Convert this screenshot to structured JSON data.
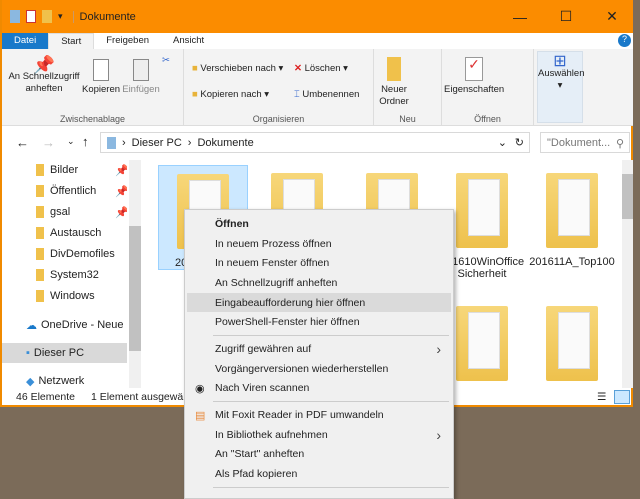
{
  "window": {
    "title": "Dokumente",
    "minimize": "—",
    "maximize": "☐",
    "close": "✕"
  },
  "ribbon_tabs": [
    "Datei",
    "Start",
    "Freigeben",
    "Ansicht"
  ],
  "ribbon": {
    "pin": "An Schnellzugriff anheften",
    "copy": "Kopieren",
    "paste": "Einfügen",
    "group_clipboard": "Zwischenablage",
    "move_to": "Verschieben nach ▾",
    "copy_to": "Kopieren nach ▾",
    "delete": "Löschen ▾",
    "rename": "Umbenennen",
    "group_organize": "Organisieren",
    "new_folder": "Neuer Ordner",
    "group_new": "Neu",
    "properties": "Eigenschaften",
    "group_open": "Öffnen",
    "select": "Auswählen"
  },
  "address": {
    "path": [
      "Dieser PC",
      "Dokumente"
    ],
    "search_placeholder": "\"Dokument..."
  },
  "nav": [
    "Bilder",
    "Öffentlich",
    "gsal",
    "Austausch",
    "DivDemofiles",
    "System32",
    "Windows",
    "OneDrive - Neue M",
    "Dieser PC",
    "Netzwerk"
  ],
  "items": [
    "20",
    "",
    "",
    "201610WinOffice Sicherheit",
    "201611A_Top100"
  ],
  "status": {
    "count": "46 Elemente",
    "selected": "1 Element ausgewählt"
  },
  "context_menu": [
    {
      "label": "Öffnen",
      "bold": true
    },
    {
      "label": "In neuem Prozess öffnen"
    },
    {
      "label": "In neuem Fenster öffnen"
    },
    {
      "label": "An Schnellzugriff anheften"
    },
    {
      "label": "Eingabeaufforderung hier öffnen",
      "highlighted": true
    },
    {
      "label": "PowerShell-Fenster hier öffnen"
    },
    {
      "label": "Zugriff gewähren auf",
      "submenu": true
    },
    {
      "label": "Vorgängerversionen wiederherstellen"
    },
    {
      "label": "Nach Viren scannen",
      "icon": "antivirus-icon"
    },
    {
      "label": "Mit Foxit Reader in PDF umwandeln",
      "icon": "foxit-icon"
    },
    {
      "label": "In Bibliothek aufnehmen",
      "submenu": true
    },
    {
      "label": "An \"Start\" anheften"
    },
    {
      "label": "Als Pfad kopieren"
    }
  ],
  "colors": {
    "titlebar": "#fb8c00",
    "file_tab": "#1979ca",
    "selection": "#cce8ff"
  }
}
